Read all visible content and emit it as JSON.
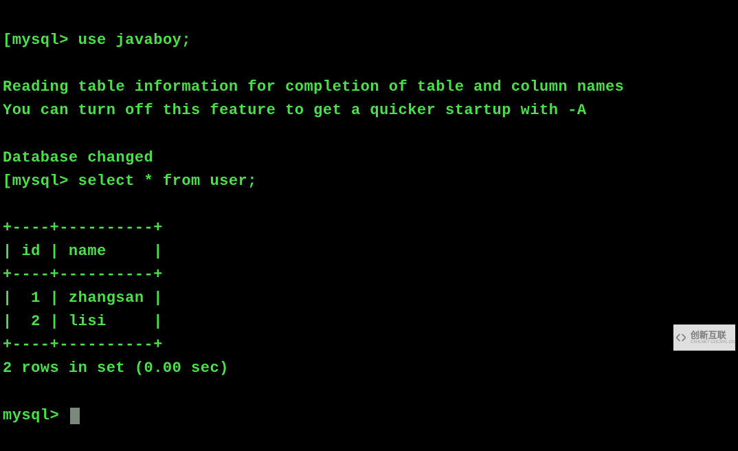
{
  "terminal": {
    "prompt_bracket": "[",
    "prompt": "mysql>",
    "line1_command": " use javaboy;",
    "line2": "Reading table information for completion of table and column names",
    "line3": "You can turn off this feature to get a quicker startup with -A",
    "blank": "",
    "line4": "Database changed",
    "line5_command": " select * from user;",
    "table_border": "+----+----------+",
    "table_header": "| id | name     |",
    "table_row1": "|  1 | zhangsan |",
    "table_row2": "|  2 | lisi     |",
    "result_summary": "2 rows in set (0.00 sec)",
    "final_prompt_space": " "
  },
  "watermark": {
    "main": "创新互联",
    "sub": "CXHLNET CDCXHL.CN"
  }
}
